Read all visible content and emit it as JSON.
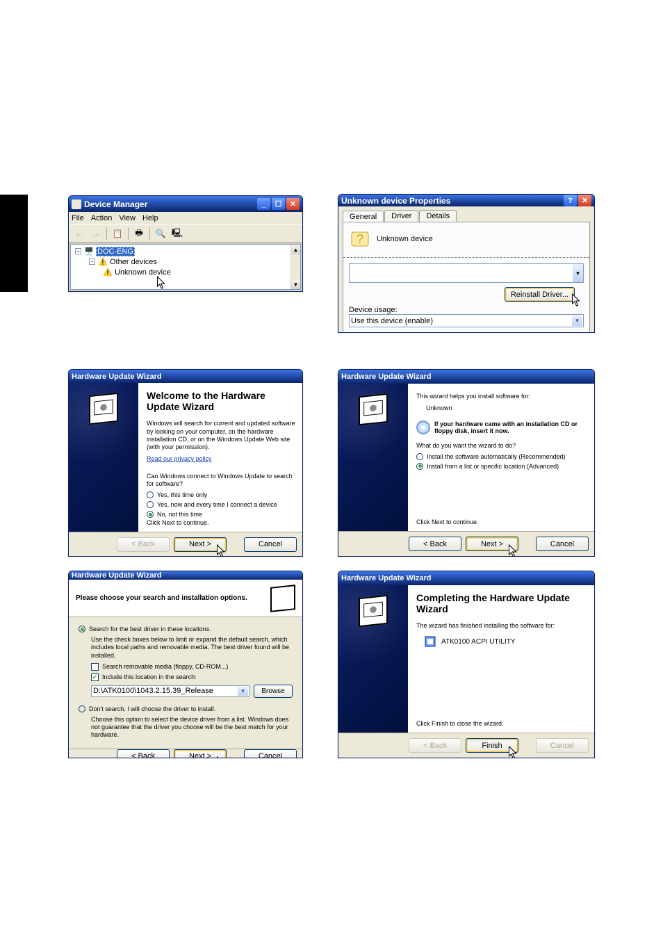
{
  "devmgr": {
    "title": "Device Manager",
    "menu": [
      "File",
      "Action",
      "View",
      "Help"
    ],
    "tree": {
      "root": "DOC-ENG",
      "group": "Other devices",
      "item": "Unknown device"
    }
  },
  "props": {
    "title": "Unknown device Properties",
    "tabs": [
      "General",
      "Driver",
      "Details"
    ],
    "device_name": "Unknown device",
    "reinstall": "Reinstall Driver...",
    "usage_label": "Device usage:",
    "usage_value": "Use this device (enable)"
  },
  "wiz_common": {
    "title": "Hardware Update Wizard",
    "back": "< Back",
    "next": "Next >",
    "cancel": "Cancel",
    "finish": "Finish",
    "privacy": "Read our privacy policy"
  },
  "wiz1": {
    "heading": "Welcome to the Hardware Update Wizard",
    "p1": "Windows will search for current and updated software by looking on your computer, on the hardware installation CD, or on the Windows Update Web site (with your permission).",
    "p2": "Can Windows connect to Windows Update to search for software?",
    "opt1": "Yes, this time only",
    "opt2": "Yes, now and every time I connect a device",
    "opt3": "No, not this time",
    "click_next": "Click Next to continue."
  },
  "wiz2": {
    "helps": "This wizard helps you install software for:",
    "device": "Unknown",
    "cd_tip": "If your hardware came with an installation CD or floppy disk, insert it now.",
    "question": "What do you want the wizard to do?",
    "opt1": "Install the software automatically (Recommended)",
    "opt2": "Install from a list or specific location (Advanced)",
    "click_next": "Click Next to continue."
  },
  "wiz3": {
    "header": "Please choose your search and installation options.",
    "r1": "Search for the best driver in these locations.",
    "r1desc": "Use the check boxes below to limit or expand the default search, which includes local paths and removable media. The best driver found will be installed.",
    "c1": "Search removable media (floppy, CD-ROM...)",
    "c2": "Include this location in the search:",
    "path": "D:\\ATK0100\\1043.2.15.39_Release",
    "browse": "Browse",
    "r2": "Don't search. I will choose the driver to install.",
    "r2desc": "Choose this option to select the device driver from a list.  Windows does not guarantee that the driver you choose will be the best match for your hardware."
  },
  "wiz4": {
    "heading": "Completing the Hardware Update Wizard",
    "finished": "The wizard has finished installing the software for:",
    "device": "ATK0100 ACPI UTILITY",
    "close": "Click Finish to close the wizard."
  }
}
